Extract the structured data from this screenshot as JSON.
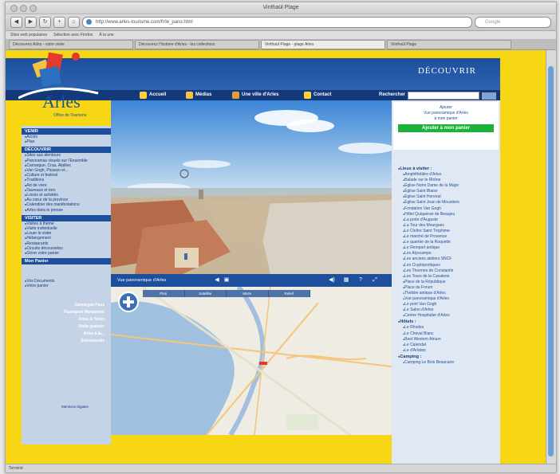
{
  "window": {
    "title": "Vinthaül Plage"
  },
  "toolbar": {
    "url": "http://www.arles-tourisme.com/fr/le_pano.html",
    "search_placeholder": "Google"
  },
  "bookmarks": [
    "Sites web populaires",
    "Sélection avec Firefox",
    "À la une"
  ],
  "tabs": [
    {
      "label": "Découvrez Arles - votre visite",
      "active": false
    },
    {
      "label": "Découvrez l'histoire d'Arles - les collections",
      "active": false
    },
    {
      "label": "Vinthaül Plage - plage Arles",
      "active": true
    },
    {
      "label": "Vinthaül Plage",
      "active": false
    }
  ],
  "site": {
    "brand": "Arles",
    "tagline": "Office de Tourisme",
    "banner": "DÉCOUVRIR",
    "nav": [
      "Accueil",
      "Médias",
      "Une ville d'Arles",
      "Contact"
    ],
    "search_label": "Rechercher",
    "left": {
      "sections": [
        {
          "title": "VENIR",
          "items": [
            "Accès",
            "Plan"
          ]
        },
        {
          "title": "DÉCOUVRIR",
          "items": [
            "Sites aux alentours",
            "Panoramas visuels sur l'Ensemble",
            "Camargue, Crau, Alpilles",
            "Van Gogh, Picasso et...",
            "Culture et festival",
            "Traditions",
            "Art de vivre",
            "Taureaux et toro",
            "Loisirs et activités",
            "Au cœur de la province",
            "Calendrier des manifestations",
            "Arles dans le presse"
          ]
        },
        {
          "title": "VISITER",
          "items": [
            "Visites à thème",
            "Visite individuelle",
            "Louer le visite",
            "Hébergement",
            "Restaurants",
            "Circuits découvertes",
            "Gérer votre panier"
          ]
        },
        {
          "title": "Mon Panier",
          "items": [
            "Vos Documents",
            "Votre panier"
          ]
        }
      ],
      "promos": [
        "Camargue Pass",
        "Passeport Monument",
        "Arles & Toros",
        "Visite gratuite",
        "Arles à la...",
        "Évènements"
      ],
      "mentions": "Mentions légales"
    },
    "pano": {
      "title": "Vue panoramique d'Arles"
    },
    "map": {
      "tabs": [
        "Plan",
        "Satellite",
        "Mixte",
        "Relief"
      ]
    },
    "right": {
      "add_text": [
        "Ajouter",
        "Vue panoramique d'Arles",
        "à mon panier"
      ],
      "add_button": "Ajouter à mon panier",
      "groups": [
        {
          "title": "Lieux à visiter :",
          "items": [
            "Amphithéâtre d'Arles",
            "Balade sur le Rhône",
            "Église Notre Dame de la Major",
            "Église Saint Blaise",
            "Église Saint Honorat",
            "Église Saint Jean de Moustiers",
            "Fondation Van Gogh",
            "Hôtel Quiqueran de Beaujeu",
            "La porte d'Auguste",
            "La Tour des Mourgues",
            "Le Cloître Saint Trophime",
            "Le marché de Provence",
            "Le quartier de la Roquette",
            "Le Rempart antique",
            "Les Alyscamps",
            "Les anciens ateliers SNCF",
            "Les Cryptoportiques",
            "Les Thermes de Constantin",
            "Les Tours de la Cavalerie",
            "Place de la République",
            "Place du Forum",
            "Théâtre antique d'Arles",
            "Vue panoramique d'Arles",
            "Le pont Van Gogh",
            "Le Salon d'Arles",
            "Centre Hospitalier d'Arles"
          ]
        },
        {
          "title": "Hôtels :",
          "items": [
            "Le Rhodes",
            "Le Cheval Blanc",
            "Best Western Atrium",
            "Le Calendal",
            "Le d'Arlatan"
          ]
        },
        {
          "title": "Camping :",
          "items": [
            "Camping Le Bois Beaucaire"
          ]
        }
      ]
    }
  },
  "status": "Terminé",
  "colors": {
    "page_bg": "#f7d614",
    "brand_blue": "#1d4f9c",
    "nav_blue": "#13397a",
    "add_green": "#1db23b"
  }
}
